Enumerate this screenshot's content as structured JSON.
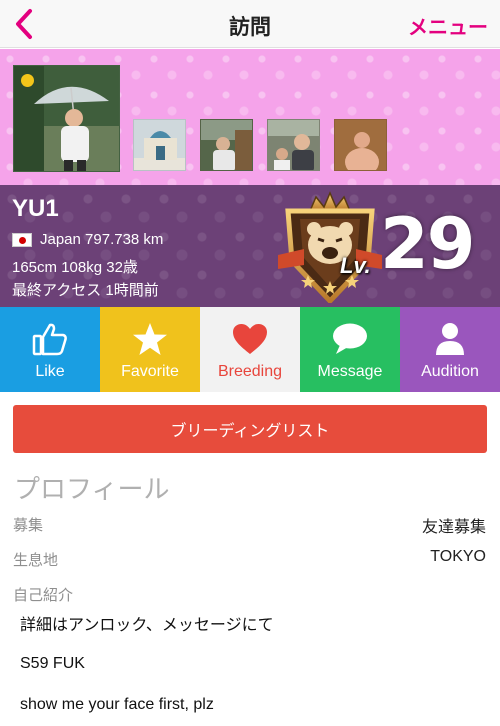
{
  "nav": {
    "back_icon": "chevron-left-icon",
    "title": "訪問",
    "menu_label": "メニュー",
    "accent_color": "#e3007f"
  },
  "photos": {
    "online_status_color": "#f3c51a",
    "items": [
      "main-photo",
      "photo-2",
      "photo-3",
      "photo-4",
      "photo-5"
    ]
  },
  "user": {
    "name": "YU1",
    "country_flag_icon": "japan-flag-icon",
    "location": "Japan 797.738 km",
    "stats": "165cm 108kg 32歳",
    "last_access": "最終アクセス 1時間前",
    "level_prefix": "Lv.",
    "level": "29",
    "badge_icon": "bear-crest-badge-icon"
  },
  "actions": [
    {
      "label": "Like",
      "icon": "thumbs-up-icon",
      "color": "#1a9ee2"
    },
    {
      "label": "Favorite",
      "icon": "star-icon",
      "color": "#f0c21c"
    },
    {
      "label": "Breeding",
      "icon": "heart-icon",
      "color": "#f2f2f2"
    },
    {
      "label": "Message",
      "icon": "speech-bubble-icon",
      "color": "#27bf61"
    },
    {
      "label": "Audition",
      "icon": "person-icon",
      "color": "#9a56bd"
    }
  ],
  "breeding_list_button": "ブリーディングリスト",
  "profile": {
    "title": "プロフィール",
    "rows": [
      {
        "label": "募集",
        "value": "友達募集"
      },
      {
        "label": "生息地",
        "value": "TOKYO"
      }
    ],
    "intro_label": "自己紹介",
    "intro_lines": [
      "詳細はアンロック、メッセージにて",
      "S59 FUK",
      "show me your face first, plz"
    ]
  }
}
